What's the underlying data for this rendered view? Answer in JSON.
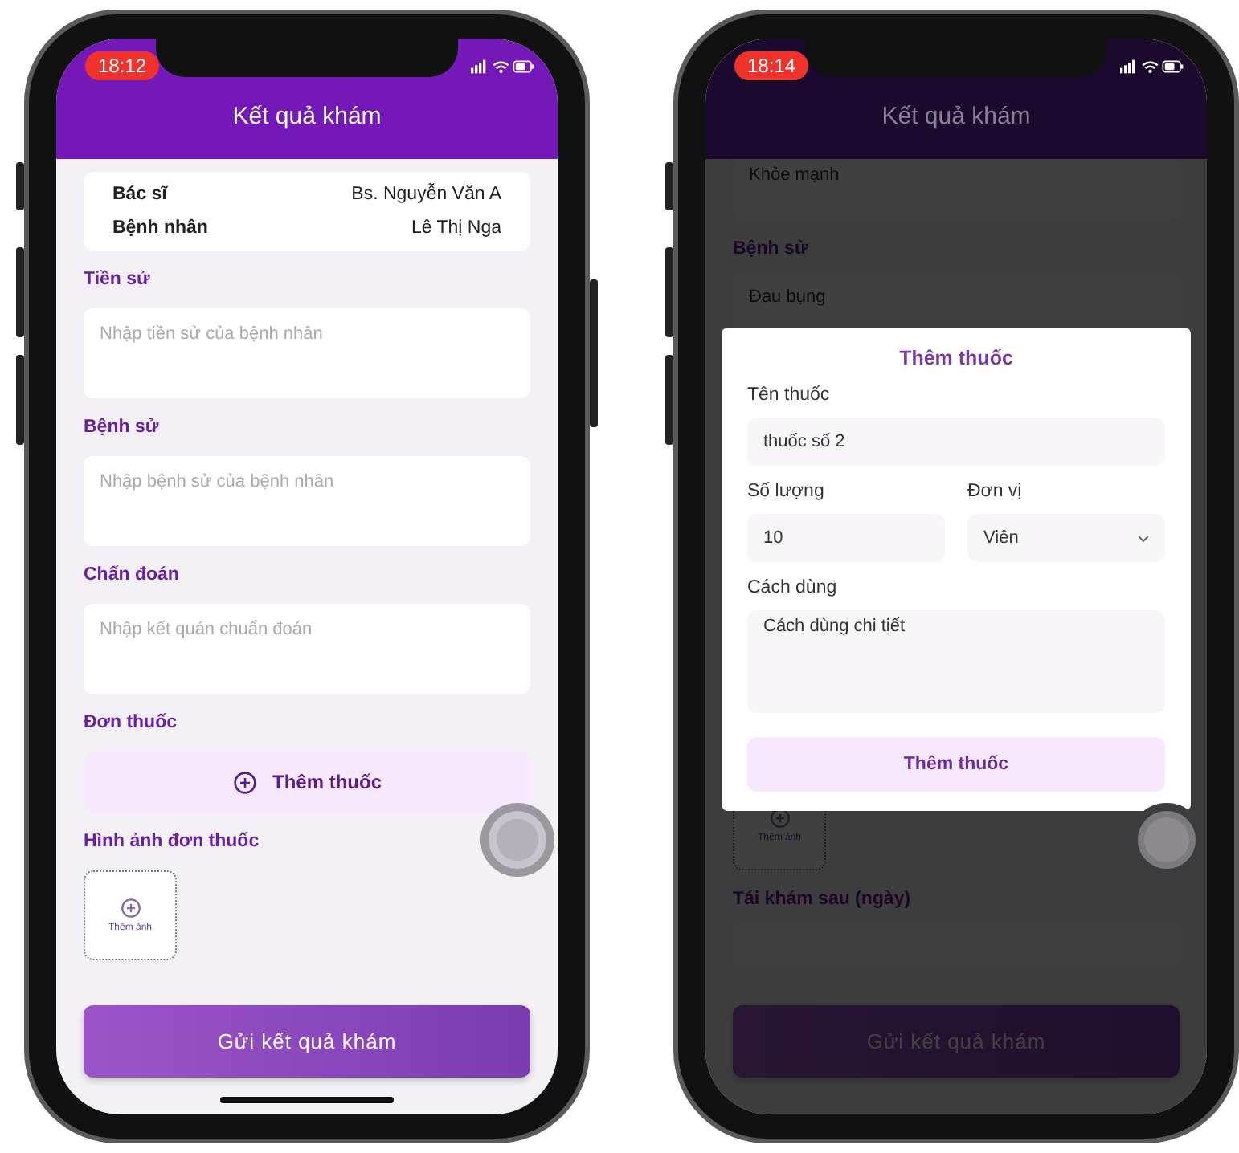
{
  "phones": [
    {
      "status_bar": {
        "time": "18:12"
      },
      "header": {
        "title": "Kết quả khám"
      },
      "sections": [
        {
          "kind": "info",
          "rows": [
            {
              "label": "Bác sĩ",
              "value": "Bs. Nguyễn Văn A"
            },
            {
              "label": "Bệnh nhân",
              "value": "Lê Thị Nga"
            }
          ]
        },
        {
          "kind": "field",
          "label": "Tiền sử",
          "placeholder": "Nhập tiền sử của bệnh nhân"
        },
        {
          "kind": "field",
          "label": "Bệnh sử",
          "placeholder": "Nhập bệnh sử của bệnh nhân"
        },
        {
          "kind": "field",
          "label": "Chấn đoán",
          "placeholder": "Nhập kết quán chuẩn đoán"
        },
        {
          "kind": "add",
          "label": "Đơn thuốc",
          "button": "Thêm thuốc"
        },
        {
          "kind": "images",
          "label": "Hình ảnh đơn thuốc",
          "tile": "Thêm ảnh"
        },
        {
          "kind": "submit",
          "button": "Gửi kết quả khám"
        }
      ]
    },
    {
      "status_bar": {
        "time": "18:14"
      },
      "header": {
        "title": "Kết quả khám"
      },
      "sections": [
        {
          "kind": "field",
          "value": "Khỏe mạnh"
        },
        {
          "kind": "field",
          "label": "Bệnh sử",
          "value": "Đau bụng"
        },
        {
          "kind": "images",
          "tile": "Thêm ảnh"
        },
        {
          "kind": "field",
          "label": "Tái khám sau (ngày)"
        },
        {
          "kind": "submit",
          "button": "Gửi kết quả khám"
        }
      ],
      "dialog": {
        "title": "Thêm thuốc",
        "fields": [
          {
            "kind": "text",
            "label": "Tên thuốc",
            "value": "thuốc số 2"
          },
          {
            "kind": "number",
            "label": "Số lượng",
            "value": "10"
          },
          {
            "kind": "select",
            "label": "Đơn vị",
            "value": "Viên"
          },
          {
            "kind": "textarea",
            "label": "Cách dùng",
            "value": "Cách dùng chi tiết"
          }
        ],
        "button": "Thêm thuốc"
      }
    }
  ]
}
